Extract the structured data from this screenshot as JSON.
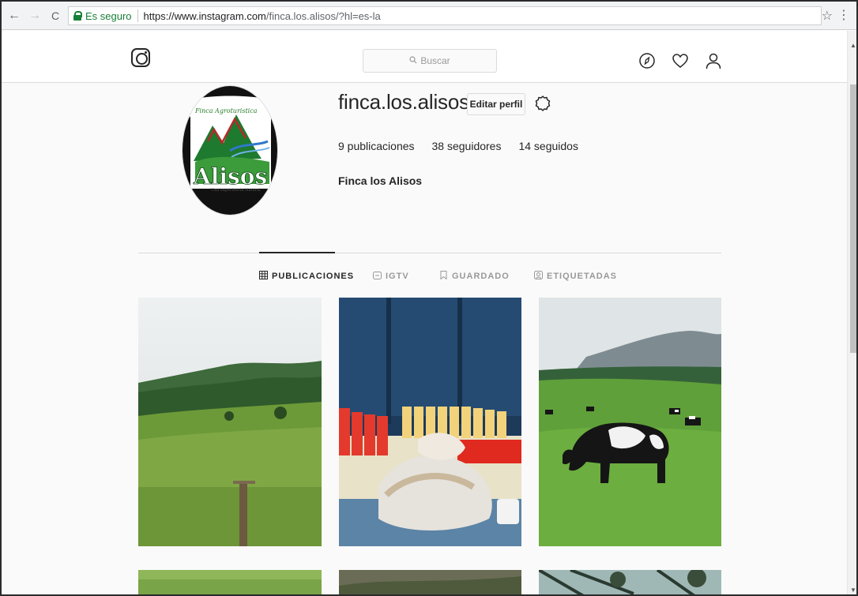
{
  "browser": {
    "back": "←",
    "forward": "→",
    "reload": "C",
    "secure_label": "Es seguro",
    "url_host": "https://www.instagram.com",
    "url_path": "/finca.los.alisos/?hl=es-la",
    "star": "☆",
    "menu": "⋮"
  },
  "ig_nav": {
    "search_placeholder": "Buscar",
    "icons": [
      "instagram-logo-icon",
      "compass-icon",
      "heart-icon",
      "person-icon"
    ]
  },
  "profile": {
    "username": "finca.los.alisos",
    "edit_button": "Editar perfil",
    "posts": "9 publicaciones",
    "followers": "38 seguidores",
    "following": "14 seguidos",
    "full_name": "Finca los Alisos",
    "avatar_logo_text": {
      "top": "Finca Agroturistica",
      "main": "Alisos",
      "tagline": "Una experiencia Natural"
    }
  },
  "tabs": [
    {
      "label": "PUBLICACIONES",
      "icon": "grid-icon",
      "active": true
    },
    {
      "label": "IGTV",
      "icon": "tv-icon",
      "active": false
    },
    {
      "label": "GUARDADO",
      "icon": "bookmark-icon",
      "active": false
    },
    {
      "label": "ETIQUETADAS",
      "icon": "tag-icon",
      "active": false
    }
  ],
  "posts": [
    {
      "subject": "green hills landscape"
    },
    {
      "subject": "food supplies on table"
    },
    {
      "subject": "cow grazing in pasture"
    },
    {
      "subject": "grass field"
    },
    {
      "subject": "trees"
    },
    {
      "subject": "tree branches"
    }
  ]
}
